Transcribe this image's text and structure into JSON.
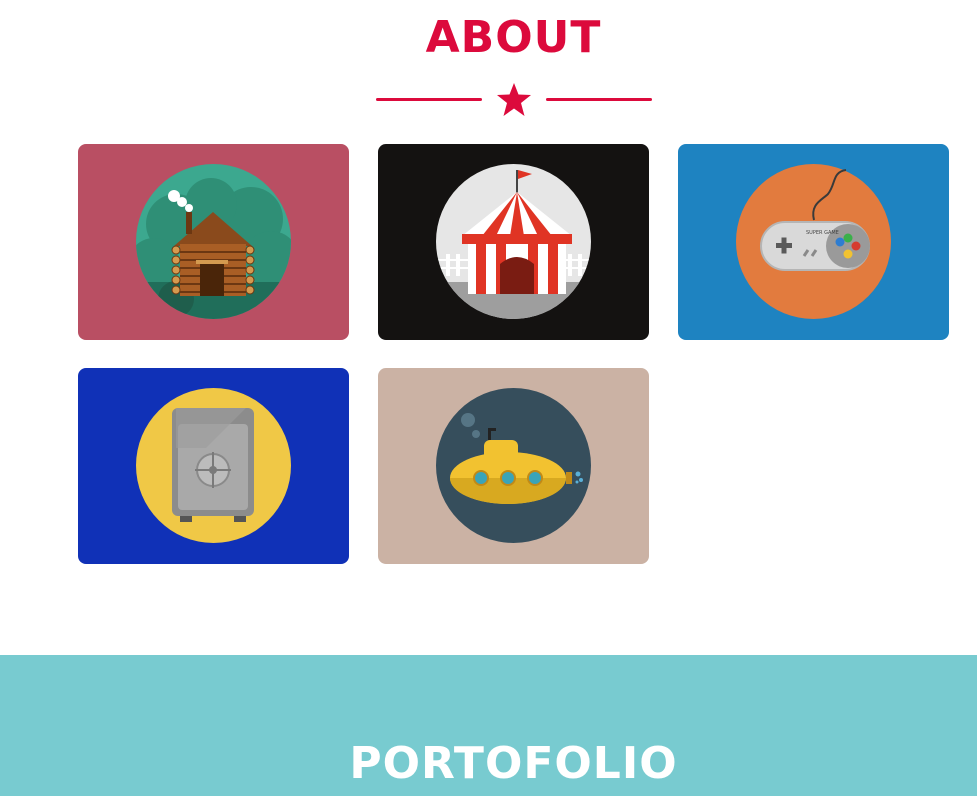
{
  "about": {
    "title": "ABOUT",
    "accent_color": "#dc0a3c",
    "divider_icon": "star-icon"
  },
  "portfolio_items": [
    {
      "icon": "cabin-icon",
      "background": "#b94f63",
      "circle_color": "#3ca88f"
    },
    {
      "icon": "circus-tent-icon",
      "background": "#141211",
      "circle_color": "#e6e6e6"
    },
    {
      "icon": "game-controller-icon",
      "background": "#1e83c1",
      "circle_color": "#e27b3e",
      "label": "SUPER GAME"
    },
    {
      "icon": "safe-icon",
      "background": "#1031b7",
      "circle_color": "#f0c846"
    },
    {
      "icon": "submarine-icon",
      "background": "#cbb2a4",
      "circle_color": "#364e5c"
    }
  ],
  "portfolio": {
    "title": "PORTOFOLIO",
    "background": "#78cbd0"
  }
}
